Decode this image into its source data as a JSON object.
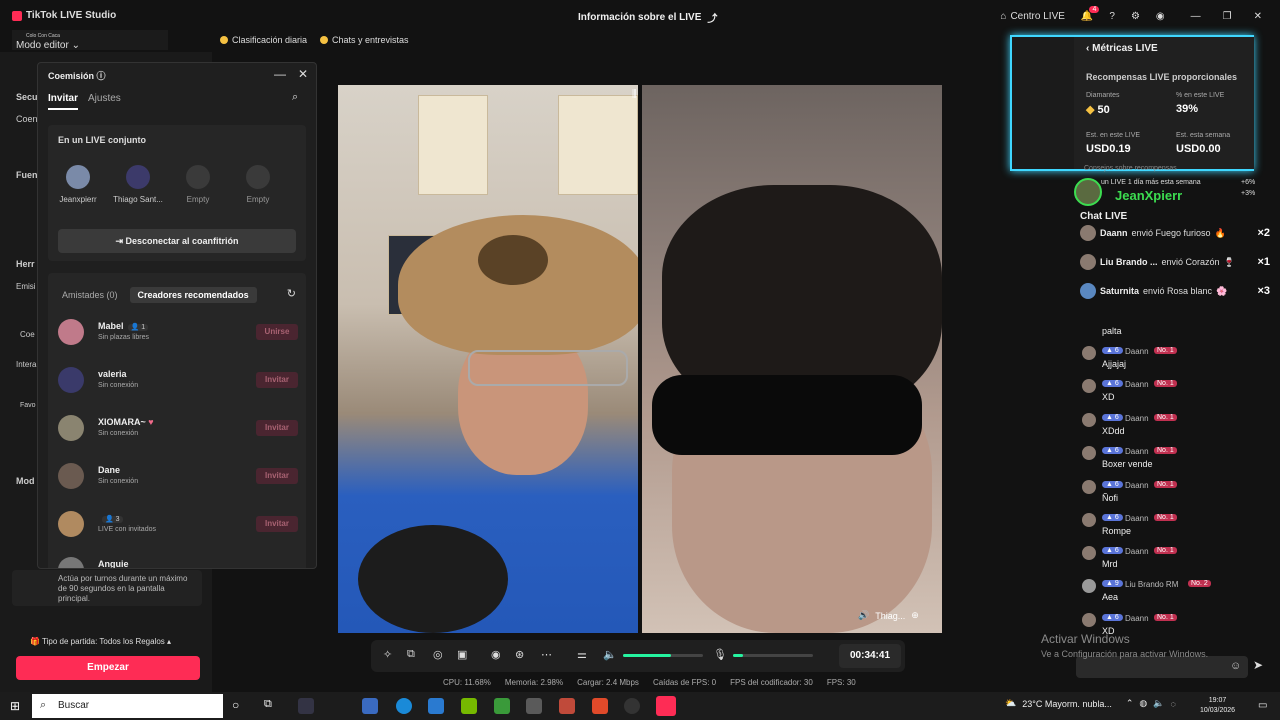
{
  "titlebar": {
    "app_title": "TikTok LIVE Studio",
    "center_title": "Información sobre el LIVE",
    "centro_live": "Centro LIVE",
    "notif_count": "4"
  },
  "overlay_top": {
    "line": "Colo Con Caca"
  },
  "left_panel": {
    "modo": "Modo editor",
    "items": [
      "Secu",
      "Coen",
      "Fuen",
      "Herr",
      "Emisi",
      "Coe",
      "Intera",
      "Favo",
      "Mod"
    ],
    "tip_text": "Actúa por turnos durante un máximo de 90 segundos en la pantalla principal.",
    "tipo_partida": "Tipo de partida: Todos los Regalos",
    "empezar": "Empezar"
  },
  "chips": {
    "clasificacion": "Clasificación diaria",
    "chats": "Chats y entrevistas"
  },
  "dialog": {
    "title": "Coemisión",
    "tabs": {
      "invitar": "Invitar",
      "ajustes": "Ajustes"
    },
    "joint_title": "En un LIVE conjunto",
    "slots": [
      {
        "name": "Jeanxpierr"
      },
      {
        "name": "Thiago Sant..."
      },
      {
        "name": "Empty"
      },
      {
        "name": "Empty"
      }
    ],
    "disconnect": "Desconectar al coanfitrión",
    "friends_tab": "Amistades (0)",
    "recommended_tab": "Creadores recomendados",
    "friends": [
      {
        "name": "Mabel",
        "count": "1",
        "status": "Sin plazas libres",
        "button": "Unirse"
      },
      {
        "name": "valeria",
        "status": "Sin conexión",
        "button": "Invitar"
      },
      {
        "name": "XIOMARA~",
        "status": "Sin conexión",
        "button": "Invitar"
      },
      {
        "name": "Dane",
        "status": "Sin conexión",
        "button": "Invitar"
      },
      {
        "name": "",
        "count": "3",
        "status": "LIVE con invitados",
        "button": "Invitar"
      },
      {
        "name": "Anguie",
        "status": "",
        "button": ""
      }
    ]
  },
  "video": {
    "guest_label": "Thiag..."
  },
  "controls": {
    "timer": "00:34:41",
    "volume": 0.6,
    "mic": 0.12
  },
  "statusbar": {
    "cpu": "CPU: 11.68%",
    "memoria": "Memoria: 2.98%",
    "cargar": "Cargar: 2.4 Mbps",
    "caidas": "Caídas de FPS: 0",
    "fps_cod": "FPS del codificador: 30",
    "fps": "FPS: 30"
  },
  "metrics": {
    "title": "Métricas LIVE",
    "subtitle": "Recompensas LIVE proporcionales",
    "diamantes_label": "Diamantes",
    "diamantes_value": "50",
    "pct_label": "% en este LIVE",
    "pct_value": "39%",
    "est_live_label": "Est. en este LIVE",
    "est_live_value": "USD0.19",
    "est_week_label": "Est. esta semana",
    "est_week_value": "USD0.00",
    "footer": "Consejos sobre recompensas"
  },
  "tips": [
    {
      "text": "un LIVE 1 día más esta semana",
      "pct": "+6%"
    },
    {
      "text": "JeanXpierr",
      "pct": "+3%"
    }
  ],
  "chat": {
    "title": "Chat LIVE",
    "gifts": [
      {
        "user": "Daann",
        "action": "envió Fuego furioso",
        "count": "×2"
      },
      {
        "user": "Liu Brando ...",
        "action": "envió Corazón",
        "count": "×1"
      },
      {
        "user": "Saturnita",
        "action": "envió Rosa blanc",
        "count": "×3"
      }
    ],
    "messages": [
      {
        "level": "",
        "user": "",
        "rank": "",
        "text": "palta"
      },
      {
        "level": "6",
        "user": "Daann",
        "rank": "No. 1",
        "text": "Ajjajaj"
      },
      {
        "level": "6",
        "user": "Daann",
        "rank": "No. 1",
        "text": "XD"
      },
      {
        "level": "6",
        "user": "Daann",
        "rank": "No. 1",
        "text": "XDdd"
      },
      {
        "level": "6",
        "user": "Daann",
        "rank": "No. 1",
        "text": "Boxer vende"
      },
      {
        "level": "6",
        "user": "Daann",
        "rank": "No. 1",
        "text": "Ñofi"
      },
      {
        "level": "6",
        "user": "Daann",
        "rank": "No. 1",
        "text": "Rompe"
      },
      {
        "level": "6",
        "user": "Daann",
        "rank": "No. 1",
        "text": "Mrd"
      },
      {
        "level": "9",
        "user": "Liu Brando RM",
        "rank": "No. 2",
        "text": "Aea"
      },
      {
        "level": "6",
        "user": "Daann",
        "rank": "No. 1",
        "text": "XD"
      }
    ]
  },
  "windows": {
    "activate_title": "Activar Windows",
    "activate_sub": "Ve a Configuración para activar Windows.",
    "search": "Buscar",
    "weather": "23°C  Mayorm. nubla...",
    "time": "19:07",
    "date": "10/03/2026"
  },
  "colors": {
    "accent": "#fe2c55",
    "metrics_border": "#3fd7ff",
    "slider": "#25f4a0"
  }
}
